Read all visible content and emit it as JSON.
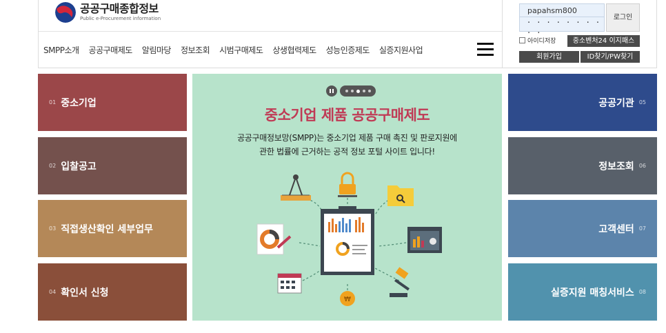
{
  "header": {
    "logo_title": "공공구매종합정보",
    "logo_subtitle": "Public e-Procurement information",
    "nav": [
      "SMPP소개",
      "공공구매제도",
      "알림마당",
      "정보조회",
      "시범구매제도",
      "상생협력제도",
      "성능인증제도",
      "실증지원사업"
    ]
  },
  "login": {
    "user_id": "papahsm800",
    "password_masked": "· · · · · · · · · ·",
    "login_label": "로그인",
    "save_id_label": "아이디저장",
    "easy_pass_label": "중소벤처24 이지패스",
    "signup_label": "회원가입",
    "find_label": "ID찾기/PW찾기"
  },
  "left_tiles": [
    {
      "num": "01",
      "label": "중소기업",
      "color": "#9b4749"
    },
    {
      "num": "02",
      "label": "입찰공고",
      "color": "#74514d"
    },
    {
      "num": "03",
      "label": "직접생산확인 세부업무",
      "color": "#b48858"
    },
    {
      "num": "04",
      "label": "확인서 신청",
      "color": "#8a4f3a"
    }
  ],
  "right_tiles": [
    {
      "num": "05",
      "label": "공공기관",
      "color": "#2e4b8c"
    },
    {
      "num": "06",
      "label": "정보조회",
      "color": "#58606a"
    },
    {
      "num": "07",
      "label": "고객센터",
      "color": "#5c84ab"
    },
    {
      "num": "08",
      "label": "실증지원 매칭서비스",
      "color": "#5192ad"
    }
  ],
  "banner": {
    "title": "중소기업 제품 공공구매제도",
    "desc_line1": "공공구매정보망(SMPP)는 중소기업 제품 구매 촉진 및 판로지원에",
    "desc_line2": "관한 법률에 근거하는 공적 정보 포털 사이트 입니다!",
    "coin_symbol": "₩",
    "pager_icon": "pause-icon",
    "bg_color": "#b7e3cb"
  }
}
